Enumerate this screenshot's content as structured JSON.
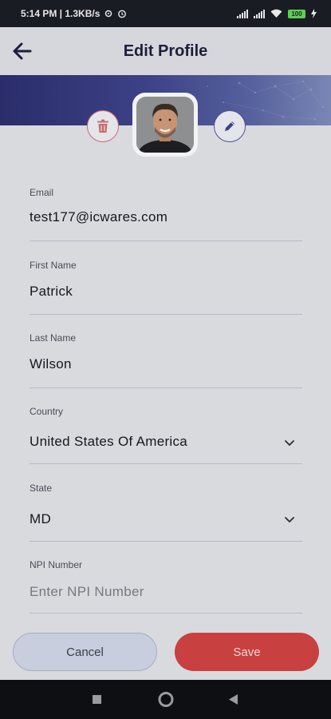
{
  "status_bar": {
    "time_speed": "5:14 PM | 1.3KB/s",
    "battery": "100"
  },
  "header": {
    "title": "Edit Profile",
    "back_icon": "arrow-left-icon"
  },
  "profile": {
    "delete_icon": "trash-icon",
    "edit_icon": "pencil-icon",
    "avatar": "profile-photo"
  },
  "form": {
    "email": {
      "label": "Email",
      "value": "test177@icwares.com"
    },
    "first_name": {
      "label": "First Name",
      "value": "Patrick"
    },
    "last_name": {
      "label": "Last Name",
      "value": "Wilson"
    },
    "country": {
      "label": "Country",
      "value": "United States Of America"
    },
    "state": {
      "label": "State",
      "value": "MD"
    },
    "npi": {
      "label": "NPI Number",
      "placeholder": "Enter NPI Number"
    }
  },
  "actions": {
    "cancel": "Cancel",
    "save": "Save"
  },
  "colors": {
    "primary": "#3d4287",
    "danger": "#c84040",
    "background": "#d9dade"
  }
}
